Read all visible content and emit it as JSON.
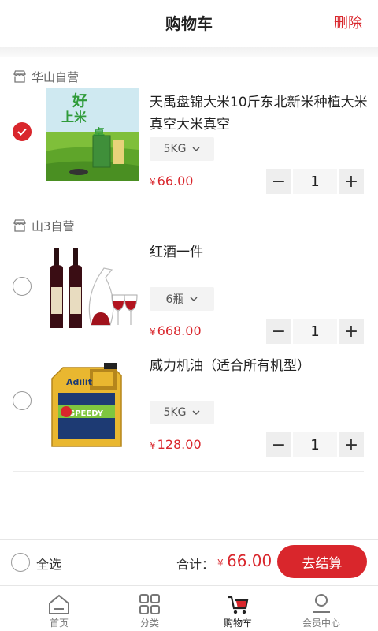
{
  "header": {
    "title": "购物车",
    "delete_label": "删除"
  },
  "stores": [
    {
      "name": "华山自营",
      "items": [
        {
          "name": "天禹盘锦大米10斤东北新米种植大米真空大米真空",
          "spec": "5KG",
          "currency": "¥",
          "price": "66.00",
          "qty": "1",
          "checked": true,
          "image_text": {
            "line1": "好",
            "line2": "上米",
            "line3": "桌"
          }
        }
      ]
    },
    {
      "name": "山3自营",
      "items": [
        {
          "name": "红酒一件",
          "spec": "6瓶",
          "currency": "¥",
          "price": "668.00",
          "qty": "1",
          "checked": false
        },
        {
          "name": "威力机油（适合所有机型）",
          "spec": "5KG",
          "currency": "¥",
          "price": "128.00",
          "qty": "1",
          "checked": false,
          "image_text": {
            "brand": "Adilit",
            "label": "SPEEDY"
          }
        }
      ]
    }
  ],
  "bottom": {
    "select_all_label": "全选",
    "total_label": "合计：",
    "currency": "¥",
    "total_value": "66.00",
    "checkout_label": "去结算"
  },
  "tabbar": [
    {
      "label": "首页",
      "icon": "home-icon"
    },
    {
      "label": "分类",
      "icon": "grid-icon"
    },
    {
      "label": "购物车",
      "icon": "cart-icon"
    },
    {
      "label": "会员中心",
      "icon": "user-icon"
    }
  ],
  "colors": {
    "accent": "#d9262c"
  }
}
